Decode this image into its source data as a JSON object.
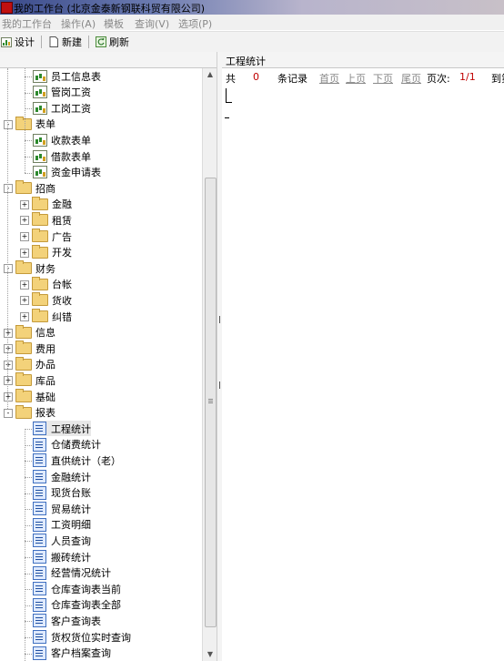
{
  "window": {
    "title": "我的工作台 (北京金泰新钢联科贸有限公司)"
  },
  "menu": [
    "我的工作台",
    "操作(A)",
    "模板",
    "查询(V)",
    "选项(P)"
  ],
  "toolbar": {
    "design": "设计",
    "new": "新建",
    "refresh": "刷新"
  },
  "right": {
    "title": "工程统计",
    "pager": {
      "total_prefix": "共",
      "count": "0",
      "records": "条记录",
      "first": "首页",
      "prev": "上页",
      "next": "下页",
      "last": "尾页",
      "page_label": "页次:",
      "page_value": "1/1",
      "goto": "到第"
    }
  },
  "tree": [
    {
      "label": "员工信息表",
      "icon": "sheet-icon"
    },
    {
      "label": "管岗工资",
      "icon": "sheet-icon"
    },
    {
      "label": "工岗工资",
      "icon": "sheet-icon"
    },
    {
      "label": "表单",
      "icon": "folder-icon"
    },
    {
      "label": "收款表单",
      "icon": "sheet-icon"
    },
    {
      "label": "借款表单",
      "icon": "sheet-icon"
    },
    {
      "label": "资金申请表",
      "icon": "sheet-icon"
    },
    {
      "label": "招商",
      "icon": "folder-icon"
    },
    {
      "label": "金融",
      "icon": "folder-icon"
    },
    {
      "label": "租赁",
      "icon": "folder-icon"
    },
    {
      "label": "广告",
      "icon": "folder-icon"
    },
    {
      "label": "开发",
      "icon": "folder-icon"
    },
    {
      "label": "财务",
      "icon": "folder-icon"
    },
    {
      "label": "台帐",
      "icon": "folder-icon"
    },
    {
      "label": "货收",
      "icon": "folder-icon"
    },
    {
      "label": "纠错",
      "icon": "folder-icon"
    },
    {
      "label": "信息",
      "icon": "folder-icon"
    },
    {
      "label": "费用",
      "icon": "folder-icon"
    },
    {
      "label": "办品",
      "icon": "folder-icon"
    },
    {
      "label": "库品",
      "icon": "folder-icon"
    },
    {
      "label": "基础",
      "icon": "folder-icon"
    },
    {
      "label": "报表",
      "icon": "folder-icon"
    },
    {
      "label": "工程统计",
      "icon": "report-icon"
    },
    {
      "label": "仓储费统计",
      "icon": "report-icon"
    },
    {
      "label": "直供统计（老）",
      "icon": "report-icon"
    },
    {
      "label": "金融统计",
      "icon": "report-icon"
    },
    {
      "label": "现货台账",
      "icon": "report-icon"
    },
    {
      "label": "贸易统计",
      "icon": "report-icon"
    },
    {
      "label": "工资明细",
      "icon": "report-icon"
    },
    {
      "label": "人员查询",
      "icon": "report-icon"
    },
    {
      "label": "搬砖统计",
      "icon": "report-icon"
    },
    {
      "label": "经营情况统计",
      "icon": "report-icon"
    },
    {
      "label": "仓库查询表当前",
      "icon": "report-icon"
    },
    {
      "label": "仓库查询表全部",
      "icon": "report-icon"
    },
    {
      "label": "客户查询表",
      "icon": "report-icon"
    },
    {
      "label": "货权货位实时查询",
      "icon": "report-icon"
    },
    {
      "label": "客户档案查询",
      "icon": "report-icon"
    }
  ]
}
